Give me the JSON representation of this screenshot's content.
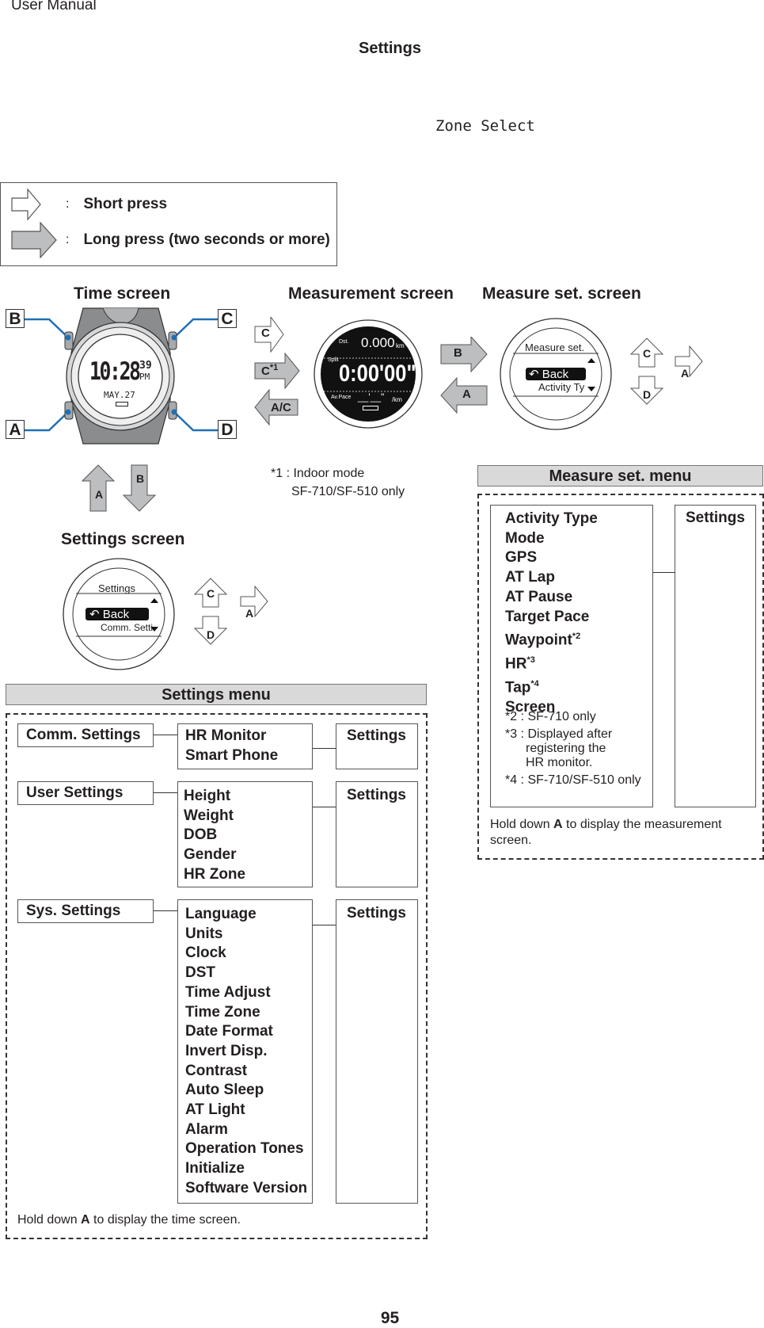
{
  "page": {
    "header": "User Manual",
    "title": "Settings",
    "mono_label": "Zone Select",
    "page_number": "95"
  },
  "legend": {
    "items": [
      {
        "icon": "outline-arrow-right-icon",
        "colon": ":",
        "label": "Short press"
      },
      {
        "icon": "filled-arrow-right-icon",
        "colon": ":",
        "label": "Long press (two seconds or more)"
      }
    ]
  },
  "time_screen": {
    "title": "Time screen",
    "buttons": [
      "A",
      "B",
      "C",
      "D"
    ],
    "watch_time": "10:28",
    "watch_seconds": "39",
    "watch_ampm": "PM",
    "watch_date": "MAY.27"
  },
  "measurement_screen": {
    "title": "Measurement screen",
    "arrows": [
      {
        "label": "C",
        "type": "short",
        "dir": "right"
      },
      {
        "label": "C",
        "sup": "*1",
        "type": "long",
        "dir": "right"
      },
      {
        "label": "A/C",
        "type": "long",
        "dir": "left"
      }
    ],
    "display": {
      "dst_label": "Dst.",
      "dst_value": "0.000",
      "dst_unit": "km",
      "split_label": "Split",
      "split_value": "0:00'00\"",
      "pace_label": "Av.Pace",
      "pace_value": "__'__\"",
      "pace_unit": "/km"
    },
    "footnote_line1": "*1 : Indoor mode",
    "footnote_line2": "SF-710/SF-510 only"
  },
  "transitions": {
    "to_measure_set": "B",
    "back_to_measurement": "A",
    "time_to_settings": "B",
    "settings_to_time": "A"
  },
  "measure_set_screen": {
    "title": "Measure set. screen",
    "display_title": "Measure set.",
    "selected": "Back",
    "next_item": "Activity Ty",
    "nav": {
      "up": "C",
      "down": "D",
      "enter": "A"
    }
  },
  "settings_screen": {
    "title": "Settings screen",
    "display_title": "Settings",
    "selected": "Back",
    "next_item": "Comm. Setti",
    "nav": {
      "up": "C",
      "down": "D",
      "enter": "A"
    }
  },
  "measure_set_menu": {
    "title": "Measure set. menu",
    "items": [
      {
        "label": "Activity Type",
        "sup": ""
      },
      {
        "label": "Mode",
        "sup": ""
      },
      {
        "label": "GPS",
        "sup": ""
      },
      {
        "label": "AT Lap",
        "sup": ""
      },
      {
        "label": "AT Pause",
        "sup": ""
      },
      {
        "label": "Target Pace",
        "sup": ""
      },
      {
        "label": "Waypoint",
        "sup": "*2"
      },
      {
        "label": "HR",
        "sup": "*3"
      },
      {
        "label": "Tap",
        "sup": "*4"
      },
      {
        "label": "Screen",
        "sup": ""
      }
    ],
    "notes": [
      "*2 : SF-710 only",
      "*3 : Displayed after",
      "registering the",
      "HR monitor.",
      "*4 : SF-710/SF-510 only"
    ],
    "settings_label": "Settings",
    "hold_prefix": "Hold down ",
    "hold_key": "A",
    "hold_suffix": " to display the measurement",
    "hold_line2": "screen."
  },
  "settings_menu": {
    "title": "Settings menu",
    "groups": [
      {
        "name": "Comm. Settings",
        "items": [
          "HR Monitor",
          "Smart Phone"
        ],
        "settings_label": "Settings"
      },
      {
        "name": "User Settings",
        "items": [
          "Height",
          "Weight",
          "DOB",
          "Gender",
          "HR Zone"
        ],
        "settings_label": "Settings"
      },
      {
        "name": "Sys. Settings",
        "items": [
          "Language",
          "Units",
          "Clock",
          "DST",
          "Time Adjust",
          "Time Zone",
          "Date Format",
          "Invert Disp.",
          "Contrast",
          "Auto Sleep",
          "AT Light",
          "Alarm",
          "Operation Tones",
          "Initialize",
          "Software Version"
        ],
        "settings_label": "Settings"
      }
    ],
    "hold_prefix": "Hold down ",
    "hold_key": "A",
    "hold_suffix": " to display the time screen."
  }
}
